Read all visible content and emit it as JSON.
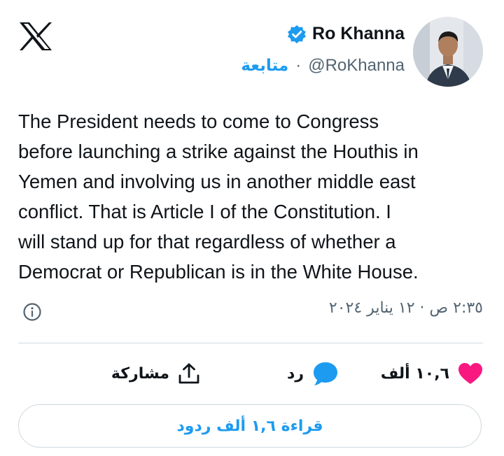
{
  "brand": {
    "logo_icon": "x-logo-icon"
  },
  "author": {
    "display_name": "Ro Khanna",
    "handle": "@RoKhanna",
    "follow_label": "متابعة",
    "separator": "·",
    "verified_icon": "verified-badge-icon",
    "verified_color": "#1d9bf0"
  },
  "tweet": {
    "lines": [
      "The President needs to come to Congress",
      "before launching a strike against the Houthis in",
      "Yemen and involving us in another middle east",
      "conflict. That is Article I of the Constitution. I",
      "will stand up for that regardless of whether a",
      "Democrat or Republican is in the White House."
    ],
    "timestamp": "٢:٣٥ ص · ١٢ يناير ٢٠٢٤",
    "info_icon": "info-icon"
  },
  "actions": {
    "like_count": "١٠,٦ ألف",
    "like_icon": "heart-icon",
    "like_color": "#f91880",
    "reply_label": "رد",
    "reply_icon": "speech-bubble-icon",
    "share_label": "مشاركة",
    "share_icon": "share-icon"
  },
  "read_replies_label": "قراءة ١,٦ ألف ردود",
  "accent_color": "#1d9bf0"
}
